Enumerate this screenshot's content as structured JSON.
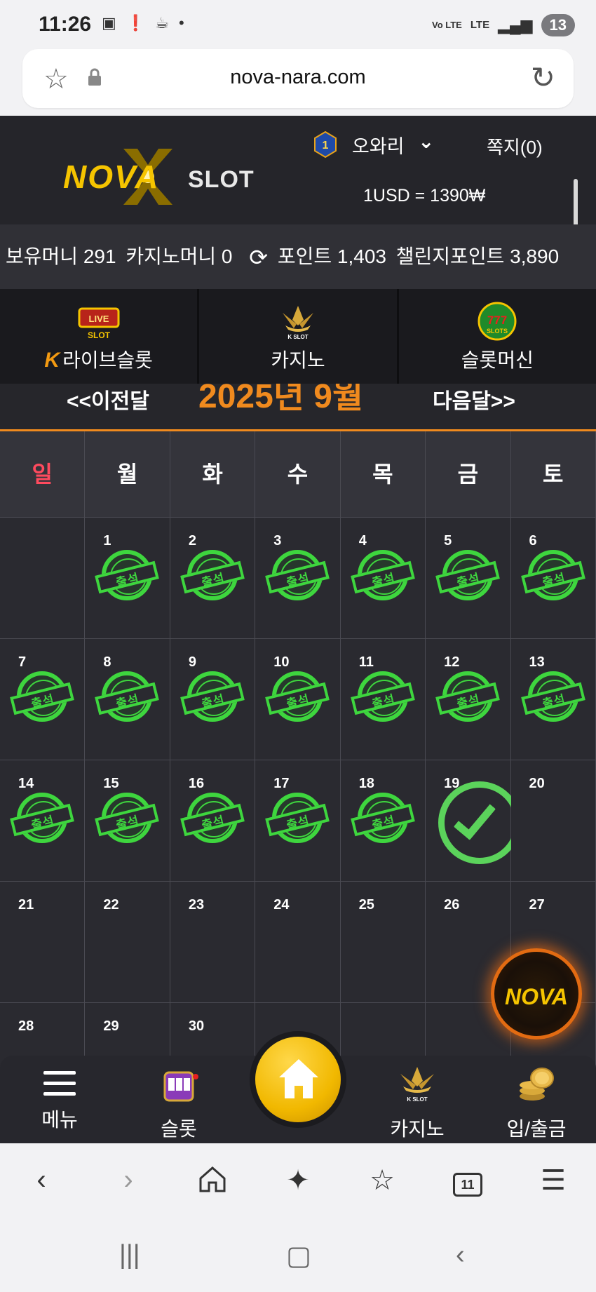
{
  "status_bar": {
    "time": "11:26",
    "badge": "13",
    "net1": "Vo LTE",
    "net2": "LTE"
  },
  "url_bar": {
    "url": "nova-nara.com"
  },
  "header": {
    "logo_left": "NOVA",
    "logo_right": "SLOT",
    "level": "1",
    "username": "오와리",
    "messages": "쪽지(0)",
    "exchange_rate": "1USD = 1390₩"
  },
  "balance": {
    "money": "보유머니 291",
    "casino_money": "카지노머니 0",
    "points": "포인트 1,403",
    "challenge_points": "챌린지포인트 3,890"
  },
  "game_tabs": [
    {
      "label": "라이브슬롯",
      "icon": "live-slot-icon",
      "badge": "K"
    },
    {
      "label": "카지노",
      "icon": "k-slot-icon"
    },
    {
      "label": "슬롯머신",
      "icon": "777-slots-icon"
    }
  ],
  "calendar": {
    "prev": "<<이전달",
    "title": "2025년 9월",
    "next": "다음달>>",
    "weekdays": [
      "일",
      "월",
      "화",
      "수",
      "목",
      "금",
      "토"
    ],
    "stamp_text": "출석",
    "attended_days": [
      1,
      2,
      3,
      4,
      5,
      6,
      7,
      8,
      9,
      10,
      11,
      12,
      13,
      14,
      15,
      16,
      17,
      18
    ],
    "today": 19,
    "days": [
      "",
      "1",
      "2",
      "3",
      "4",
      "5",
      "6",
      "7",
      "8",
      "9",
      "10",
      "11",
      "12",
      "13",
      "14",
      "15",
      "16",
      "17",
      "18",
      "19",
      "20",
      "21",
      "22",
      "23",
      "24",
      "25",
      "26",
      "27",
      "28",
      "29",
      "30"
    ]
  },
  "fab": {
    "label": "NOVA"
  },
  "site_nav": {
    "menu": "메뉴",
    "slot": "슬롯",
    "casino": "카지노",
    "deposit": "입/출금"
  },
  "browser_bar": {
    "tabs_count": "11"
  },
  "colors": {
    "accent": "#f08a1e",
    "stamp_green": "#3ed63e",
    "gold": "#f5c400",
    "background": "#1d1d22"
  }
}
